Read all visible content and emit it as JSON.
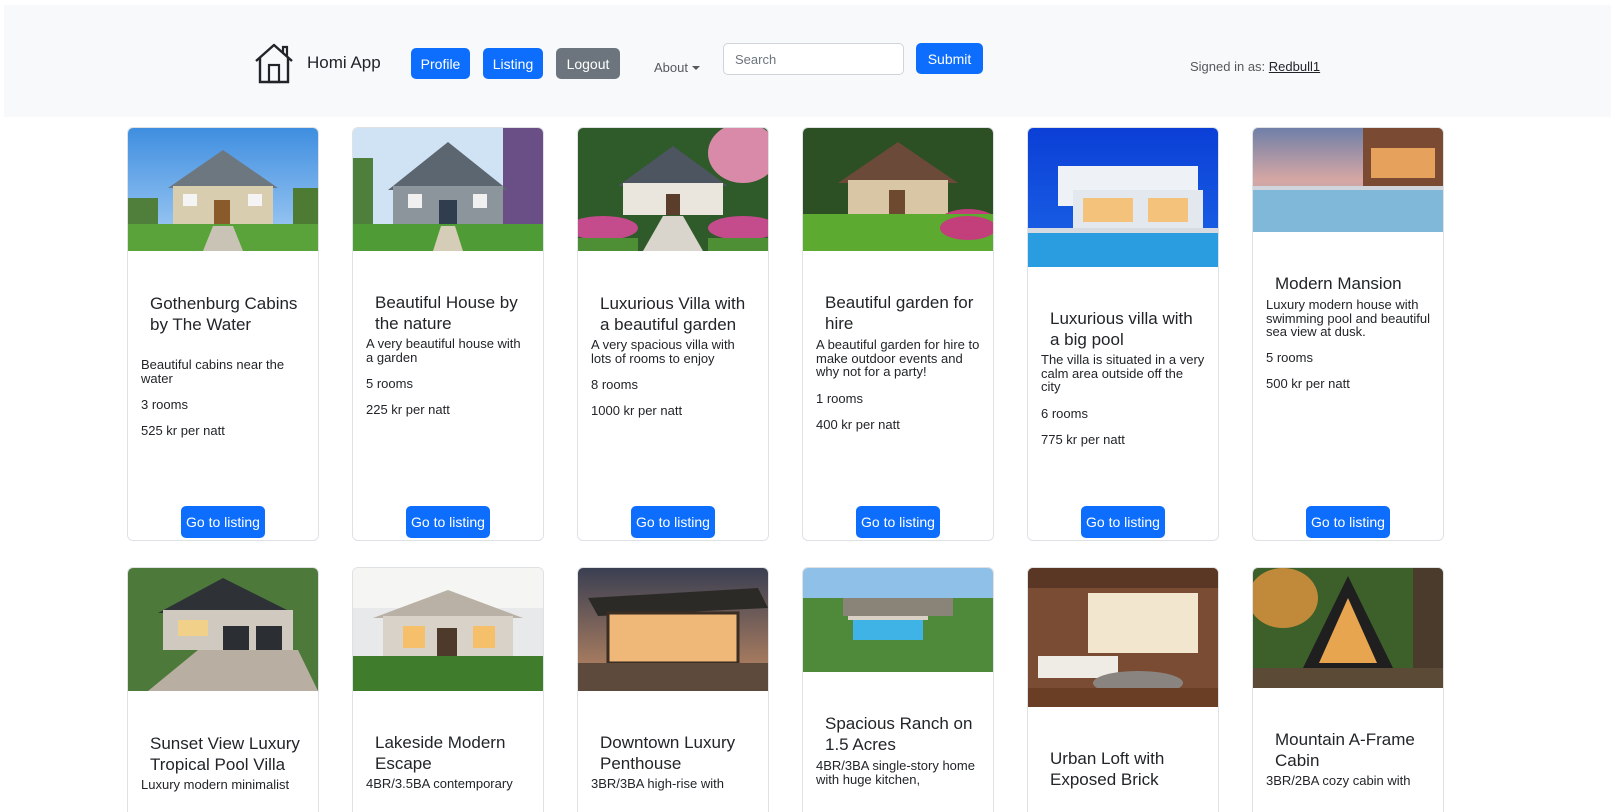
{
  "brand": {
    "name": "Homi App",
    "logo_icon": "house-icon"
  },
  "nav": {
    "profile_label": "Profile",
    "listing_label": "Listing",
    "logout_label": "Logout",
    "about_label": "About",
    "search_placeholder": "Search",
    "submit_label": "Submit",
    "signed_in_prefix": "Signed in as:",
    "username": "Redbull1"
  },
  "colors": {
    "primary": "#0d6efd",
    "secondary": "#6c757d",
    "navbar_bg": "#f8f9fa"
  },
  "listings": [
    {
      "title": "Gothenburg Cabins by The Water",
      "description": "Beautiful cabins near the water",
      "rooms": "3 rooms",
      "price": "525 kr per natt",
      "button": "Go to listing"
    },
    {
      "title": "Beautiful House by the nature",
      "description": "A very beautiful house with a garden",
      "rooms": "5 rooms",
      "price": "225 kr per natt",
      "button": "Go to listing"
    },
    {
      "title": "Luxurious Villa with a beautiful garden",
      "description": "A very spacious villa with lots of rooms to enjoy",
      "rooms": "8 rooms",
      "price": "1000 kr per natt",
      "button": "Go to listing"
    },
    {
      "title": "Beautiful garden for hire",
      "description": "A beautiful garden for hire to make outdoor events and why not for a party!",
      "rooms": "1 rooms",
      "price": "400 kr per natt",
      "button": "Go to listing"
    },
    {
      "title": "Luxurious villa with a big pool",
      "description": "The villa is situated in a very calm area outside off the city",
      "rooms": "6 rooms",
      "price": "775 kr per natt",
      "button": "Go to listing"
    },
    {
      "title": "Modern Mansion",
      "description": "Luxury modern house with swimming pool and beautiful sea view at dusk.",
      "rooms": "5 rooms",
      "price": "500 kr per natt",
      "button": "Go to listing"
    },
    {
      "title": "Sunset View Luxury Tropical Pool Villa",
      "description": "Luxury modern minimalist"
    },
    {
      "title": "Lakeside Modern Escape",
      "description": "4BR/3.5BA contemporary"
    },
    {
      "title": "Downtown Luxury Penthouse",
      "description": "3BR/3BA high-rise with"
    },
    {
      "title": "Spacious Ranch on 1.5 Acres",
      "description": "4BR/3BA single-story home with huge kitchen,"
    },
    {
      "title": "Urban Loft with Exposed Brick",
      "description": ""
    },
    {
      "title": "Mountain A-Frame Cabin",
      "description": "3BR/2BA cozy cabin with"
    }
  ]
}
